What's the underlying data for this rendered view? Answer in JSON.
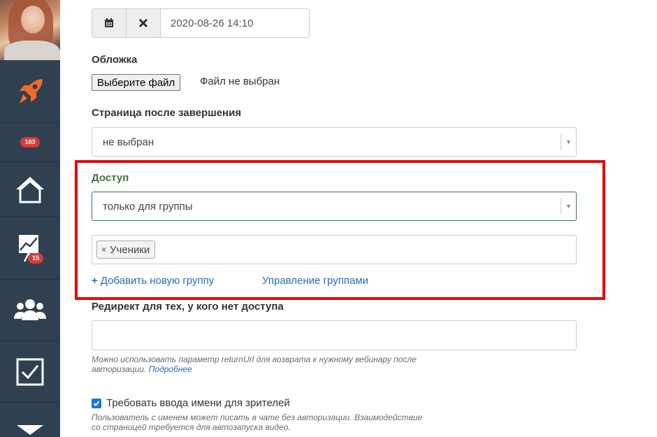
{
  "sidebar": {
    "badges": {
      "notifications": "103",
      "stats": "15"
    }
  },
  "date": {
    "value": "2020-08-26 14:10"
  },
  "cover": {
    "label": "Обложка",
    "button_label": "Выберите файл",
    "status": "Файл не выбран"
  },
  "finish_page": {
    "label": "Страница после завершения",
    "selected": "не выбран"
  },
  "access": {
    "label": "Доступ",
    "selected": "только для группы",
    "tags": [
      "Ученики"
    ],
    "add_group_link": "Добавить новую группу",
    "manage_groups_link": "Управление группами"
  },
  "redirect": {
    "label": "Редирект для тех, у кого нет доступа",
    "value": "",
    "hint_text": "Можно использовать параметр returnUrl для возврата к нужному вебинару после авторизации.",
    "hint_link": "Подробнее"
  },
  "require_name": {
    "checked": true,
    "label": "Требовать ввода имени для зрителей",
    "hint": "Пользователь с именем может писать в чате без авторизации. Взаимодействие со страницей требуется для автозапуска видео."
  },
  "colors": {
    "sidebar": "#2f4050",
    "accent_green": "#3c763d",
    "link": "#2a6bb3",
    "highlight": "#e20b0b",
    "badge": "#d83a3a"
  }
}
